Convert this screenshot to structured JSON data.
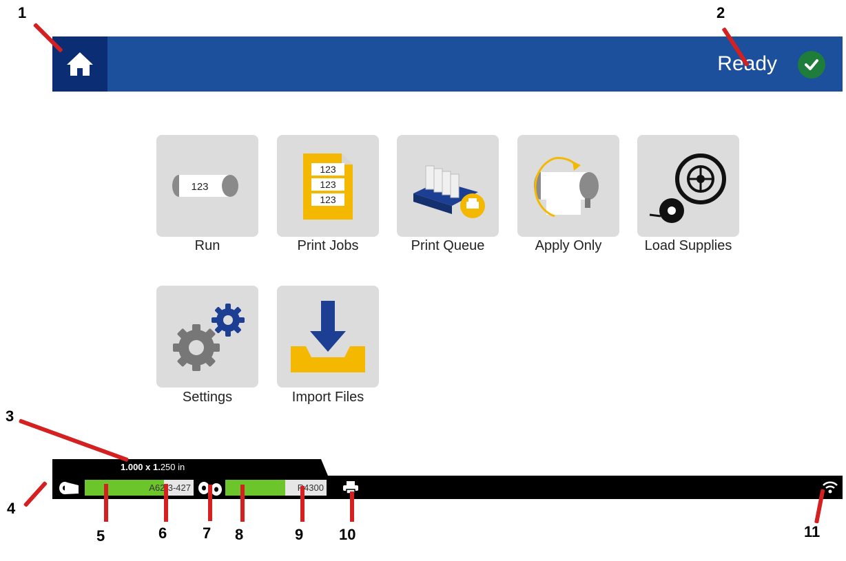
{
  "header": {
    "status_label": "Ready"
  },
  "tiles": [
    {
      "label": "Run"
    },
    {
      "label": "Print Jobs"
    },
    {
      "label": "Print Queue"
    },
    {
      "label": "Apply Only"
    },
    {
      "label": "Load Supplies"
    },
    {
      "label": "Settings"
    },
    {
      "label": "Import Files"
    }
  ],
  "run_icon": {
    "text": "123"
  },
  "print_jobs_icon": {
    "line1": "123",
    "line2": "123",
    "line3": "123"
  },
  "statusbar": {
    "label_size": {
      "bold": "1.000 x 1.",
      "normal": "250 in"
    },
    "label_supply": {
      "part_number": "A62-3-427",
      "remaining_fraction": 0.73
    },
    "ribbon_supply": {
      "part_number": "R4300",
      "remaining_fraction": 0.59
    }
  },
  "callouts": [
    "1",
    "2",
    "3",
    "4",
    "5",
    "6",
    "7",
    "8",
    "9",
    "10",
    "11"
  ],
  "colors": {
    "header": "#1c4f9c",
    "home": "#0a2d73",
    "ready_check": "#1e7d3a",
    "supply_fill": "#6cc62b",
    "callout_line": "#d42020",
    "tile": "#dcdcdc",
    "accent_yellow": "#f5b800"
  }
}
